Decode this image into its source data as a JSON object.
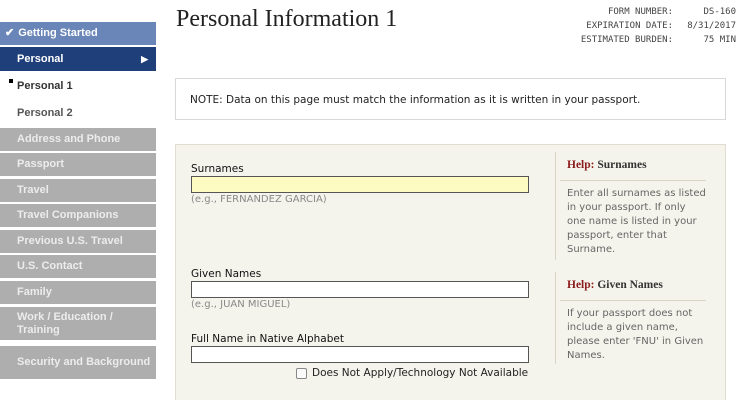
{
  "sidebar": {
    "getting_started": "Getting Started",
    "personal": "Personal",
    "personal_1": "Personal 1",
    "personal_2": "Personal 2",
    "items": [
      "Address and Phone",
      "Passport",
      "Travel",
      "Travel Companions",
      "Previous U.S. Travel",
      "U.S. Contact",
      "Family",
      "Work / Education / Training",
      "Security and Background"
    ]
  },
  "header": {
    "title": "Personal Information 1",
    "form_number_label": "FORM NUMBER:",
    "form_number_value": "DS-160",
    "expiration_label": "EXPIRATION DATE:",
    "expiration_value": "8/31/2017",
    "burden_label": "ESTIMATED BURDEN:",
    "burden_value": "75 MIN"
  },
  "note": "NOTE: Data on this page must match the information as it is written in your passport.",
  "form": {
    "surnames_label": "Surnames",
    "surnames_value": "",
    "surnames_example": "(e.g., FERNANDEZ GARCIA)",
    "given_names_label": "Given Names",
    "given_names_value": "",
    "given_names_example": "(e.g., JUAN MIGUEL)",
    "native_name_label": "Full Name in Native Alphabet",
    "native_name_value": "",
    "does_not_apply_label": "Does Not Apply/Technology Not Available",
    "does_not_apply_checked": false
  },
  "help": {
    "prefix": "Help:",
    "surnames_title": "Surnames",
    "surnames_text": "Enter all surnames as listed in your passport. If only one name is listed in your passport, enter that Surname.",
    "given_names_title": "Given Names",
    "given_names_text": "If your passport does not include a given name, please enter 'FNU' in Given Names."
  },
  "colors": {
    "nav_active": "#1e3f7a",
    "nav_completed": "#6a86b8",
    "nav_pending": "#aeaeae",
    "focused_field": "#fdfbc2",
    "help_accent": "#8b1a1a"
  }
}
